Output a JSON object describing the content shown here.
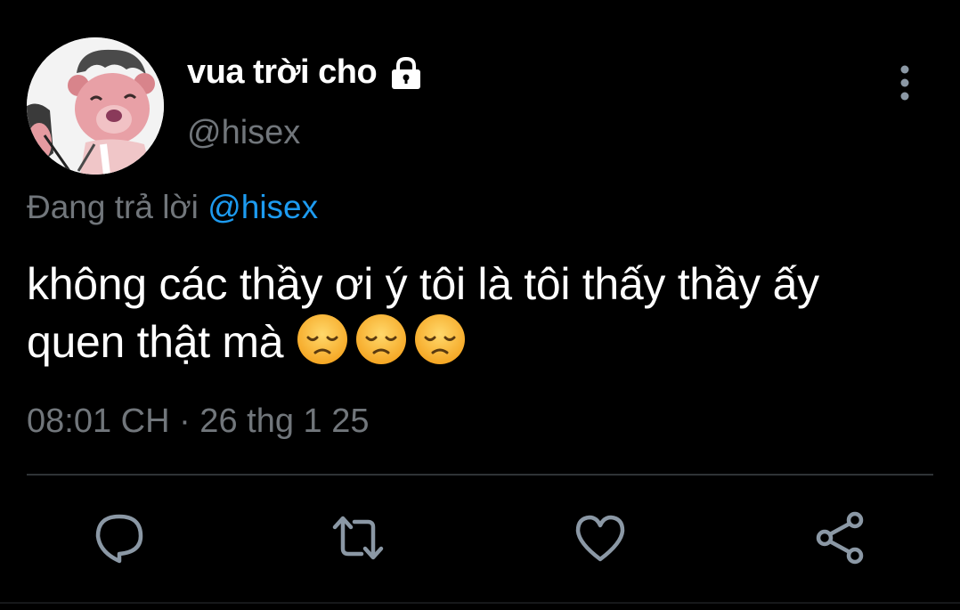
{
  "user": {
    "display_name": "vua trời cho",
    "handle": "@hisex",
    "protected_icon": "lock-icon",
    "avatar_icon": "cartoon-bear-avatar"
  },
  "reply": {
    "prefix": "Đang trả lời",
    "mention": "@hisex"
  },
  "tweet": {
    "text": "không các thầy ơi ý tôi là tôi thấy thầy ấy quen thật mà",
    "emojis": [
      "disappointed-face-emoji",
      "disappointed-face-emoji",
      "disappointed-face-emoji"
    ]
  },
  "meta": {
    "timestamp": "08:01 CH · 26 thg 1 25"
  },
  "actions": {
    "reply_icon": "reply-icon",
    "retweet_icon": "retweet-icon",
    "like_icon": "heart-icon",
    "share_icon": "share-icon"
  },
  "colors": {
    "background": "#000000",
    "text_primary": "#ffffff",
    "text_secondary": "#71767b",
    "accent": "#1d9bf0",
    "divider": "#2f3336",
    "icon": "#8b98a5"
  }
}
